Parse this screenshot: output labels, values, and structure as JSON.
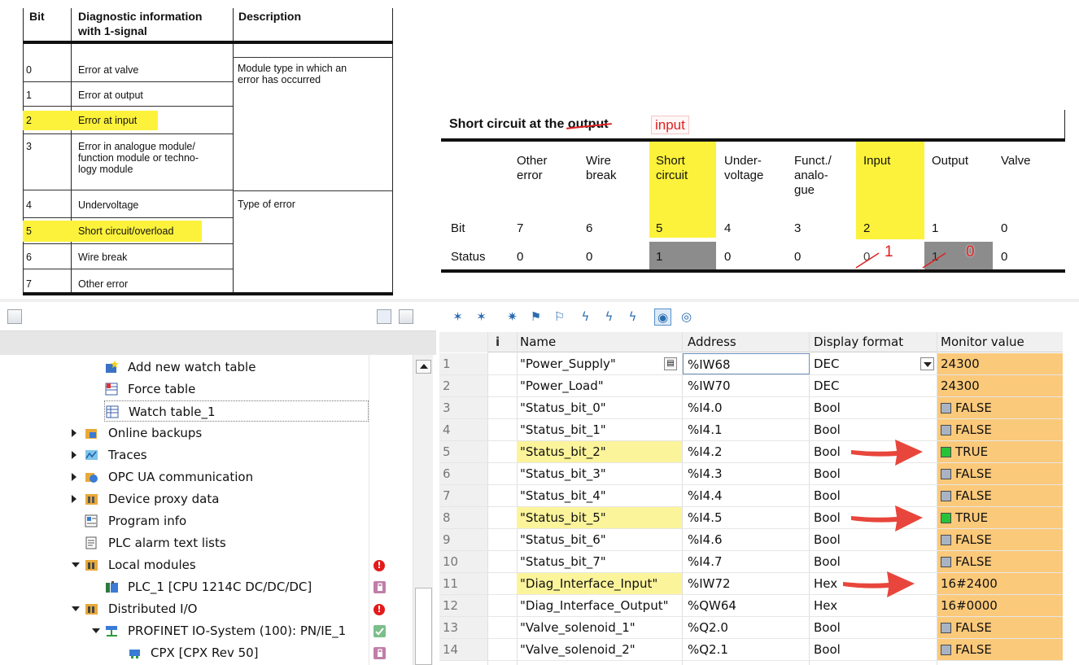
{
  "doc_table1": {
    "headers": [
      "Bit",
      "Diagnostic information with 1-signal",
      "Description"
    ],
    "header_line1": "Diagnostic information",
    "header_line2": "with 1-signal",
    "rows": [
      {
        "bit": "0",
        "info": "Error at valve"
      },
      {
        "bit": "1",
        "info": "Error at output"
      },
      {
        "bit": "2",
        "info": "Error at input"
      },
      {
        "bit": "3",
        "info_lines": [
          "Error in analogue module/",
          "function module or techno-",
          "logy module"
        ]
      },
      {
        "bit": "4",
        "info": "Undervoltage"
      },
      {
        "bit": "5",
        "info": "Short circuit/overload"
      },
      {
        "bit": "6",
        "info": "Wire break"
      },
      {
        "bit": "7",
        "info": "Other error"
      }
    ],
    "desc_module_lines": [
      "Module type in which an",
      "error has occurred"
    ],
    "desc_error": "Type of error",
    "highlight_color": "#fdf23b"
  },
  "doc_table2": {
    "title_prefix": "Short circuit at the ",
    "title_struck": "output",
    "annotation": "input",
    "columns": [
      {
        "lines": [
          "Other",
          "error"
        ],
        "bit": "7",
        "status": "0"
      },
      {
        "lines": [
          "Wire",
          "break"
        ],
        "bit": "6",
        "status": "0"
      },
      {
        "lines": [
          "Short",
          "circuit"
        ],
        "bit": "5",
        "status": "1"
      },
      {
        "lines": [
          "Under-",
          "voltage"
        ],
        "bit": "4",
        "status": "0"
      },
      {
        "lines": [
          "Funct./",
          "analo-",
          "gue"
        ],
        "bit": "3",
        "status": "0"
      },
      {
        "lines": [
          "Input"
        ],
        "bit": "2",
        "status": "0",
        "corrected": "1"
      },
      {
        "lines": [
          "Output"
        ],
        "bit": "1",
        "status": "1",
        "corrected": "0"
      },
      {
        "lines": [
          "Valve"
        ],
        "bit": "0",
        "status": "0"
      }
    ],
    "row_bit": "Bit",
    "row_status": "Status"
  },
  "project_tree": {
    "items": [
      {
        "label": "Add new watch table",
        "icon": "add-watch-table-icon"
      },
      {
        "label": "Force table",
        "icon": "force-table-icon"
      },
      {
        "label": "Watch table_1",
        "icon": "watch-table-icon"
      },
      {
        "label": "Online backups",
        "icon": "online-backups-icon"
      },
      {
        "label": "Traces",
        "icon": "traces-icon"
      },
      {
        "label": "OPC UA communication",
        "icon": "opc-ua-icon"
      },
      {
        "label": "Device proxy data",
        "icon": "device-proxy-icon"
      },
      {
        "label": "Program info",
        "icon": "program-info-icon"
      },
      {
        "label": "PLC alarm text lists",
        "icon": "alarm-text-icon"
      },
      {
        "label": "Local modules",
        "icon": "folder-icon"
      },
      {
        "label": "PLC_1 [CPU 1214C DC/DC/DC]",
        "icon": "plc-icon"
      },
      {
        "label": "Distributed I/O",
        "icon": "folder-icon"
      },
      {
        "label": "PROFINET IO-System (100): PN/IE_1",
        "icon": "profinet-icon"
      },
      {
        "label": "CPX [CPX Rev 50]",
        "icon": "device-icon"
      }
    ]
  },
  "watch_table": {
    "headers": {
      "info": "i",
      "name": "Name",
      "address": "Address",
      "format": "Display format",
      "monitor": "Monitor value"
    },
    "rows": [
      {
        "n": "1",
        "name": "\"Power_Supply\"",
        "address": "%IW68",
        "format": "DEC",
        "value": "24300"
      },
      {
        "n": "2",
        "name": "\"Power_Load\"",
        "address": "%IW70",
        "format": "DEC",
        "value": "24300"
      },
      {
        "n": "3",
        "name": "\"Status_bit_0\"",
        "address": "%I4.0",
        "format": "Bool",
        "value": "FALSE"
      },
      {
        "n": "4",
        "name": "\"Status_bit_1\"",
        "address": "%I4.1",
        "format": "Bool",
        "value": "FALSE"
      },
      {
        "n": "5",
        "name": "\"Status_bit_2\"",
        "address": "%I4.2",
        "format": "Bool",
        "value": "TRUE"
      },
      {
        "n": "6",
        "name": "\"Status_bit_3\"",
        "address": "%I4.3",
        "format": "Bool",
        "value": "FALSE"
      },
      {
        "n": "7",
        "name": "\"Status_bit_4\"",
        "address": "%I4.4",
        "format": "Bool",
        "value": "FALSE"
      },
      {
        "n": "8",
        "name": "\"Status_bit_5\"",
        "address": "%I4.5",
        "format": "Bool",
        "value": "TRUE"
      },
      {
        "n": "9",
        "name": "\"Status_bit_6\"",
        "address": "%I4.6",
        "format": "Bool",
        "value": "FALSE"
      },
      {
        "n": "10",
        "name": "\"Status_bit_7\"",
        "address": "%I4.7",
        "format": "Bool",
        "value": "FALSE"
      },
      {
        "n": "11",
        "name": "\"Diag_Interface_Input\"",
        "address": "%IW72",
        "format": "Hex",
        "value": "16#2400"
      },
      {
        "n": "12",
        "name": "\"Diag_Interface_Output\"",
        "address": "%QW64",
        "format": "Hex",
        "value": "16#0000"
      },
      {
        "n": "13",
        "name": "\"Valve_solenoid_1\"",
        "address": "%Q2.0",
        "format": "Bool",
        "value": "FALSE"
      },
      {
        "n": "14",
        "name": "\"Valve_solenoid_2\"",
        "address": "%Q2.1",
        "format": "Bool",
        "value": "FALSE"
      }
    ],
    "monitor_color": "#fbc97a",
    "name_highlight_color": "#fbf49b"
  }
}
